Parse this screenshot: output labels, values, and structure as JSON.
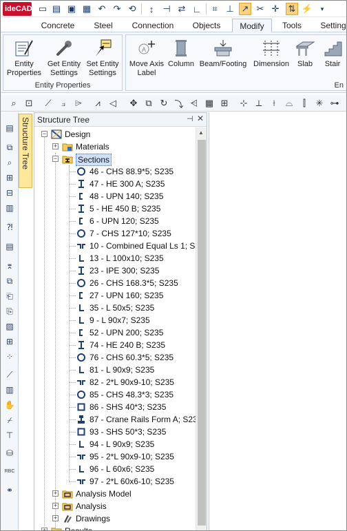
{
  "app": {
    "logo_text": "ideCAD"
  },
  "tabs": [
    "Concrete",
    "Steel",
    "Connection",
    "Objects",
    "Modify",
    "Tools",
    "Setting"
  ],
  "active_tab": "Modify",
  "ribbon": {
    "entity_group_label": "Entity Properties",
    "buttons_left": [
      {
        "label": "Entity Properties"
      },
      {
        "label": "Get Entity Settings"
      },
      {
        "label": "Set Entity Settings"
      }
    ],
    "buttons_right": [
      {
        "label": "Move Axis Label"
      },
      {
        "label": "Column"
      },
      {
        "label": "Beam/Footing"
      },
      {
        "label": "Dimension"
      },
      {
        "label": "Slab"
      },
      {
        "label": "Stair"
      }
    ],
    "right_group_label_partial": "En"
  },
  "panel": {
    "side_tab_label": "Structure Tree",
    "title": "Structure Tree",
    "pin_icon": "pin-icon",
    "close_icon": "close-icon"
  },
  "tree": {
    "root": "Design",
    "materials": "Materials",
    "sections": "Sections",
    "items": [
      {
        "label": "46 - CHS 88.9*5; S235",
        "shape": "circle"
      },
      {
        "label": "47 - HE 300 A; S235",
        "shape": "i"
      },
      {
        "label": "48 - UPN 140; S235",
        "shape": "c"
      },
      {
        "label": "5 - HE 450 B; S235",
        "shape": "i"
      },
      {
        "label": "6 - UPN 120; S235",
        "shape": "c"
      },
      {
        "label": "7 - CHS 127*10; S235",
        "shape": "circle"
      },
      {
        "label": "10 - Combined Equal Ls 1; S2",
        "shape": "double-l"
      },
      {
        "label": "13 - L 100x10; S235",
        "shape": "l"
      },
      {
        "label": "23 - IPE 300; S235",
        "shape": "i"
      },
      {
        "label": "26 - CHS 168.3*5; S235",
        "shape": "circle"
      },
      {
        "label": "27 - UPN 160; S235",
        "shape": "c"
      },
      {
        "label": "35 - L 50x5; S235",
        "shape": "l"
      },
      {
        "label": "9 - L 90x7; S235",
        "shape": "l"
      },
      {
        "label": "52 - UPN 200; S235",
        "shape": "c"
      },
      {
        "label": "74 - HE 240 B; S235",
        "shape": "i"
      },
      {
        "label": "76 - CHS 60.3*5; S235",
        "shape": "circle"
      },
      {
        "label": "81 - L 90x9; S235",
        "shape": "l"
      },
      {
        "label": "82 - 2*L 90x9-10; S235",
        "shape": "double-l"
      },
      {
        "label": "85 - CHS 48.3*3; S235",
        "shape": "circle"
      },
      {
        "label": "86 - SHS 40*3; S235",
        "shape": "square"
      },
      {
        "label": "87 - Crane Rails Form A; S23",
        "shape": "rail"
      },
      {
        "label": "93 - SHS 50*3; S235",
        "shape": "square"
      },
      {
        "label": "94 - L 90x9; S235",
        "shape": "l"
      },
      {
        "label": "95 - 2*L 90x9-10; S235",
        "shape": "double-l"
      },
      {
        "label": "96 - L 60x6; S235",
        "shape": "l"
      },
      {
        "label": "97 - 2*L 60x6-10; S235",
        "shape": "double-l"
      }
    ],
    "after": [
      {
        "label": "Analysis Model"
      },
      {
        "label": "Analysis"
      },
      {
        "label": "Drawings"
      },
      {
        "label": "Results"
      }
    ]
  }
}
